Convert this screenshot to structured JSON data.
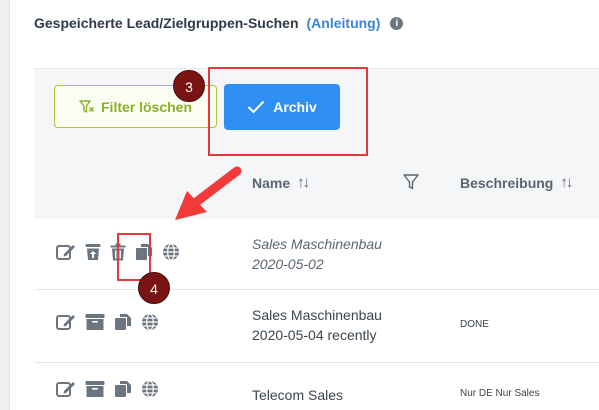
{
  "header": {
    "title": "Gespeicherte Lead/Zielgruppen-Suchen",
    "guide_link": "(Anleitung)",
    "info_icon": "info-icon"
  },
  "toolbar": {
    "filter_clear_label": "Filter löschen",
    "archive_label": "Archiv"
  },
  "table": {
    "columns": [
      {
        "label": "Name",
        "sort_icon": "↑↓"
      },
      {
        "label": "Beschreibung",
        "sort_icon": "↑↓"
      }
    ],
    "rows": [
      {
        "name_line1": "Sales Maschinenbau",
        "name_line2": "2020-05-02",
        "description": "",
        "archived": true,
        "actions": [
          "edit-icon",
          "unarchive-icon",
          "delete-icon",
          "copy-icon",
          "globe-icon"
        ]
      },
      {
        "name_line1": "Sales Maschinenbau",
        "name_line2": "2020-05-04 recently",
        "description": "DONE",
        "archived": false,
        "actions": [
          "edit-icon",
          "archive-icon",
          "copy-icon",
          "globe-icon"
        ]
      },
      {
        "name_line1": "Telecom Sales",
        "name_line2": "",
        "description": "Nur DE Nur Sales",
        "archived": false,
        "actions": [
          "edit-icon",
          "archive-icon",
          "copy-icon",
          "globe-icon"
        ]
      }
    ]
  },
  "annotations": {
    "badge_3": "3",
    "badge_4": "4",
    "highlight_color": "#e33b3b",
    "badge_color": "#7a1414"
  },
  "colors": {
    "primary_button": "#2f8ff2",
    "filter_button": "#8bb02a",
    "link": "#3a86d4"
  }
}
